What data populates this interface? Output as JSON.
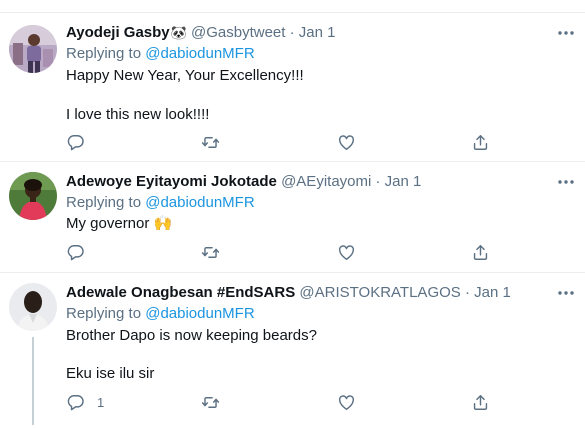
{
  "tweets": [
    {
      "name": "Ayodeji Gasby",
      "name_emoji": "🐼",
      "handle": "@Gasbytweet",
      "dot": "·",
      "date": "Jan 1",
      "replying_prefix": "Replying to",
      "replying_to": "@dabiodunMFR",
      "lines": [
        "Happy New Year, Your Excellency!!!",
        "I love this new look!!!!"
      ],
      "reply_count": ""
    },
    {
      "name": "Adewoye Eyitayomi Jokotade",
      "name_emoji": "",
      "handle": "@AEyitayomi",
      "dot": "·",
      "date": "Jan 1",
      "replying_prefix": "Replying to",
      "replying_to": "@dabiodunMFR",
      "lines": [
        "My governor 🙌"
      ],
      "reply_count": ""
    },
    {
      "name": "Adewale Onagbesan #EndSARS",
      "name_emoji": "",
      "handle": "@ARISTOKRATLAGOS",
      "dot": "·",
      "date": "Jan 1",
      "replying_prefix": "Replying to",
      "replying_to": "@dabiodunMFR",
      "lines": [
        "Brother Dapo is now keeping beards?",
        "Eku ise ilu sir"
      ],
      "reply_count": "1"
    }
  ],
  "colors": {
    "text": "#0f1419",
    "secondary": "#5b7083",
    "link": "#1b95e0",
    "divider": "#ebeef0"
  },
  "icons": [
    "more-icon",
    "reply-icon",
    "retweet-icon",
    "like-icon",
    "share-icon"
  ]
}
